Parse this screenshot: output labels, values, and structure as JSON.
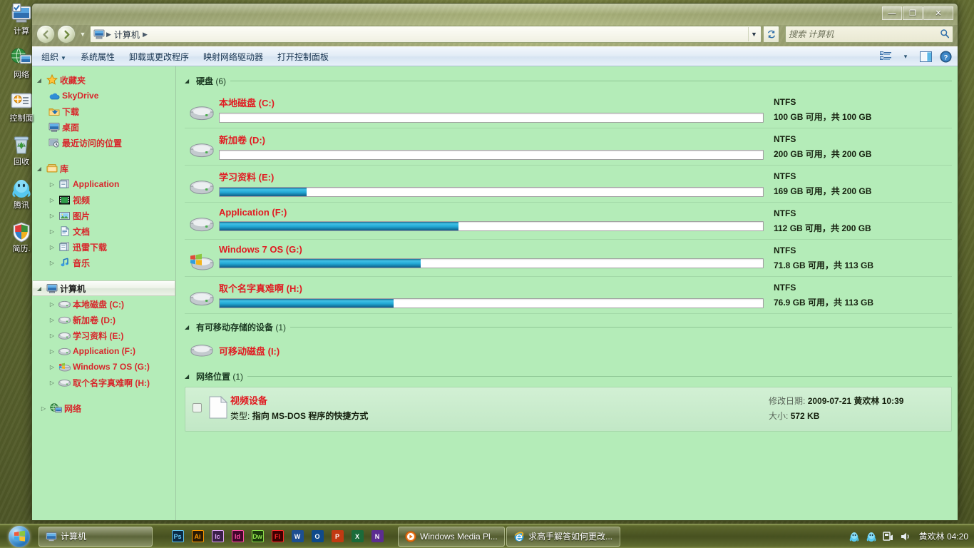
{
  "desktop": {
    "icons": [
      {
        "label": "计算",
        "icon": "computer-icon"
      },
      {
        "label": "网络",
        "icon": "network-icon"
      },
      {
        "label": "控制面",
        "icon": "control-panel-icon"
      },
      {
        "label": "回收",
        "icon": "recycle-bin-icon"
      },
      {
        "label": "腾讯",
        "icon": "qq-icon"
      },
      {
        "label": "简历.",
        "icon": "shield-file-icon"
      }
    ]
  },
  "window": {
    "buttons": {
      "minimize": "—",
      "maximize": "❐",
      "close": "✕"
    }
  },
  "address": {
    "back_icon": "back-arrow-icon",
    "forward_icon": "forward-arrow-icon",
    "history_icon": "chevron-down-icon",
    "crumbs": [
      "计算机"
    ],
    "dropdown_icon": "chevron-down-icon",
    "refresh_icon": "refresh-icon"
  },
  "search": {
    "placeholder": "搜索 计算机",
    "value": "",
    "icon": "search-icon"
  },
  "command_bar": {
    "organize": "组织",
    "items": [
      "系统属性",
      "卸载或更改程序",
      "映射网络驱动器",
      "打开控制面板"
    ],
    "view_icon": "view-list-icon",
    "view_caret": "▾",
    "preview_icon": "preview-pane-icon",
    "help_icon": "help-icon"
  },
  "nav_pane": {
    "favorites": {
      "label": "收藏夹",
      "icon": "star-icon",
      "items": [
        {
          "label": "SkyDrive",
          "icon": "skydrive-icon"
        },
        {
          "label": "下载",
          "icon": "downloads-icon"
        },
        {
          "label": "桌面",
          "icon": "desktop-icon"
        },
        {
          "label": "最近访问的位置",
          "icon": "recent-places-icon"
        }
      ]
    },
    "libraries": {
      "label": "库",
      "icon": "library-icon",
      "items": [
        {
          "label": "Application",
          "icon": "library-generic-icon"
        },
        {
          "label": "视频",
          "icon": "video-icon"
        },
        {
          "label": "图片",
          "icon": "pictures-icon"
        },
        {
          "label": "文档",
          "icon": "documents-icon"
        },
        {
          "label": "迅雷下载",
          "icon": "library-generic-icon"
        },
        {
          "label": "音乐",
          "icon": "music-icon"
        }
      ]
    },
    "computer": {
      "label": "计算机",
      "icon": "computer-icon",
      "items": [
        {
          "label": "本地磁盘 (C:)",
          "icon": "drive-icon"
        },
        {
          "label": "新加卷 (D:)",
          "icon": "drive-icon"
        },
        {
          "label": "学习资料 (E:)",
          "icon": "drive-icon"
        },
        {
          "label": "Application (F:)",
          "icon": "drive-icon"
        },
        {
          "label": "Windows 7 OS (G:)",
          "icon": "windows-drive-icon"
        },
        {
          "label": "取个名字真难啊 (H:)",
          "icon": "drive-icon"
        }
      ]
    },
    "network": {
      "label": "网络",
      "icon": "network-icon"
    }
  },
  "content": {
    "hard_disks": {
      "title": "硬盘",
      "count": "(6)",
      "drives": [
        {
          "name": "本地磁盘 (C:)",
          "fs": "NTFS",
          "capacity": "100 GB 可用，共 100 GB",
          "used_percent": 0,
          "icon": "drive-icon"
        },
        {
          "name": "新加卷 (D:)",
          "fs": "NTFS",
          "capacity": "200 GB 可用，共 200 GB",
          "used_percent": 0,
          "icon": "drive-icon"
        },
        {
          "name": "学习资料 (E:)",
          "fs": "NTFS",
          "capacity": "169 GB 可用，共 200 GB",
          "used_percent": 16,
          "icon": "drive-icon"
        },
        {
          "name": "Application (F:)",
          "fs": "NTFS",
          "capacity": "112 GB 可用，共 200 GB",
          "used_percent": 44,
          "icon": "drive-icon"
        },
        {
          "name": "Windows 7 OS (G:)",
          "fs": "NTFS",
          "capacity": "71.8 GB 可用，共 113 GB",
          "used_percent": 37,
          "icon": "windows-drive-icon"
        },
        {
          "name": "取个名字真难啊 (H:)",
          "fs": "NTFS",
          "capacity": "76.9 GB 可用，共 113 GB",
          "used_percent": 32,
          "icon": "drive-icon"
        }
      ]
    },
    "removable": {
      "title": "有可移动存储的设备",
      "count": "(1)",
      "items": [
        {
          "name": "可移动磁盘 (I:)",
          "icon": "removable-drive-icon"
        }
      ]
    },
    "network_locations": {
      "title": "网络位置",
      "count": "(1)",
      "items": [
        {
          "name": "视频设备",
          "type_label": "类型:",
          "type_value": "指向 MS-DOS 程序的快捷方式",
          "modified_label": "修改日期:",
          "modified_value": "2009-07-21 黄欢林 10:39",
          "size_label": "大小:",
          "size_value": "572 KB",
          "icon": "file-icon"
        }
      ]
    }
  },
  "taskbar": {
    "start_icon": "windows-start-orb",
    "active_task": {
      "label": "计算机",
      "icon": "computer-icon"
    },
    "quick_launch": [
      {
        "label": "Ps",
        "color": "#2b5d8c",
        "text": "#6fc5f5"
      },
      {
        "label": "Ai",
        "color": "#3a2a10",
        "text": "#ff9a00"
      },
      {
        "label": "Ic",
        "color": "#5b2b6b",
        "text": "#e0a6f5"
      },
      {
        "label": "Id",
        "color": "#4b0a33",
        "text": "#ff4fa3"
      },
      {
        "label": "Dw",
        "color": "#1d3d0d",
        "text": "#8fe04a"
      },
      {
        "label": "Fl",
        "color": "#3d0000",
        "text": "#ff2a2a"
      },
      {
        "label": "W",
        "color": "#1d4f91",
        "text": "#ffffff"
      },
      {
        "label": "O",
        "color": "#0f4a8a",
        "text": "#ffffff"
      },
      {
        "label": "P",
        "color": "#c23a12",
        "text": "#ffffff"
      },
      {
        "label": "X",
        "color": "#1b6b3a",
        "text": "#ffffff"
      },
      {
        "label": "N",
        "color": "#5c2d91",
        "text": "#ffffff"
      }
    ],
    "tasks": [
      {
        "label": "Windows Media Pl...",
        "icon": "wmp-icon"
      },
      {
        "label": "求高手解答如何更改...",
        "icon": "ie-icon"
      }
    ],
    "tray": [
      {
        "icon": "qq-tray-icon"
      },
      {
        "icon": "qq-tray-icon-2"
      },
      {
        "icon": "action-center-icon"
      },
      {
        "icon": "volume-icon"
      }
    ],
    "clock": "黄欢林 04:20"
  },
  "colors": {
    "content_bg": "#b4ecb8",
    "drive_name": "#e11b22",
    "group_title": "#1b3a22",
    "meter_fill": "#22a8d4"
  }
}
